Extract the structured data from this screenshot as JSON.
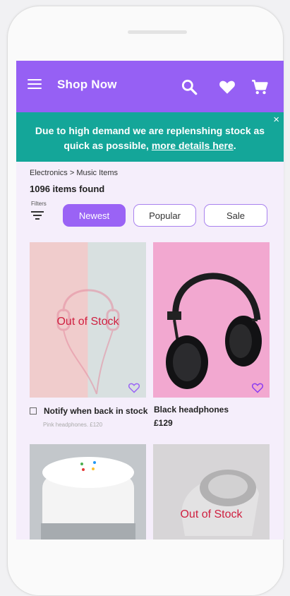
{
  "app": {
    "title": "Shop Now"
  },
  "icons": {
    "menu": "menu-icon",
    "search": "search-icon",
    "favorite": "heart-icon",
    "cart": "cart-icon",
    "filter": "filter-icon",
    "close": "close-icon"
  },
  "banner": {
    "text": "Due to high demand we are replenshing stock as quick as possible, ",
    "link": "more details here",
    "tail": ".",
    "close": "×"
  },
  "breadcrumb": "Electronics > Music Items",
  "results": "1096 items found",
  "filters": {
    "label": "Filters",
    "chips": [
      "Newest",
      "Popular",
      "Sale"
    ],
    "active": "Newest"
  },
  "products": [
    {
      "oos": "Out of  Stock",
      "notify": "Notify when back in stock",
      "sub": "Pink headphones. £120"
    },
    {
      "name": "Black headphones",
      "price": "£129"
    },
    {},
    {
      "oos": "Out of Stock"
    }
  ],
  "colors": {
    "accent": "#9660f4",
    "banner": "#14a699",
    "oos": "#cf2040"
  }
}
